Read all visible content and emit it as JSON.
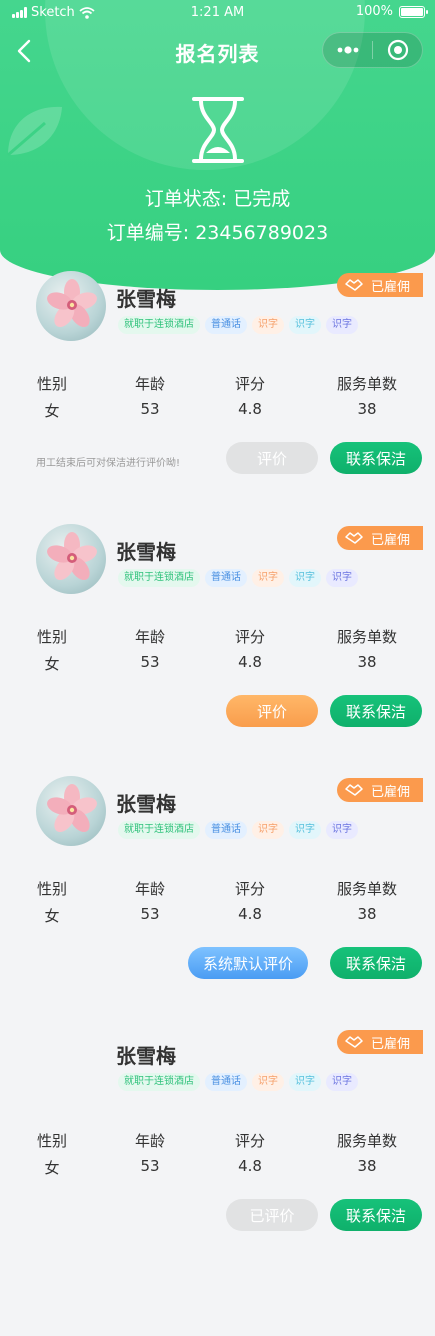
{
  "status_bar": {
    "carrier": "Sketch",
    "time": "1:21 AM",
    "battery": "100%"
  },
  "nav": {
    "title": "报名列表"
  },
  "order": {
    "status_text": "订单状态: 已完成",
    "number_text": "订单编号: 23456789023"
  },
  "stat_labels": {
    "gender": "性别",
    "age": "年龄",
    "rating": "评分",
    "orders": "服务单数"
  },
  "colors": {
    "primary_green": "#36d080",
    "badge_orange": "#fb9a4d",
    "button_green": "#0fb06b"
  },
  "cards": [
    {
      "name": "张雪梅",
      "badge": "已雇佣",
      "tags": [
        "就职于连锁酒店",
        "普通话",
        "识字",
        "识字",
        "识字"
      ],
      "gender": "女",
      "age": "53",
      "rating": "4.8",
      "orders": "38",
      "note": "用工结束后可对保洁进行评价呦!",
      "action_label": "评价",
      "contact_label": "联系保洁"
    },
    {
      "name": "张雪梅",
      "badge": "已雇佣",
      "tags": [
        "就职于连锁酒店",
        "普通话",
        "识字",
        "识字",
        "识字"
      ],
      "gender": "女",
      "age": "53",
      "rating": "4.8",
      "orders": "38",
      "action_label": "评价",
      "contact_label": "联系保洁"
    },
    {
      "name": "张雪梅",
      "badge": "已雇佣",
      "tags": [
        "就职于连锁酒店",
        "普通话",
        "识字",
        "识字",
        "识字"
      ],
      "gender": "女",
      "age": "53",
      "rating": "4.8",
      "orders": "38",
      "action_label": "系统默认评价",
      "contact_label": "联系保洁"
    },
    {
      "name": "张雪梅",
      "badge": "已雇佣",
      "tags": [
        "就职于连锁酒店",
        "普通话",
        "识字",
        "识字",
        "识字"
      ],
      "gender": "女",
      "age": "53",
      "rating": "4.8",
      "orders": "38",
      "action_label": "已评价",
      "contact_label": "联系保洁"
    }
  ]
}
